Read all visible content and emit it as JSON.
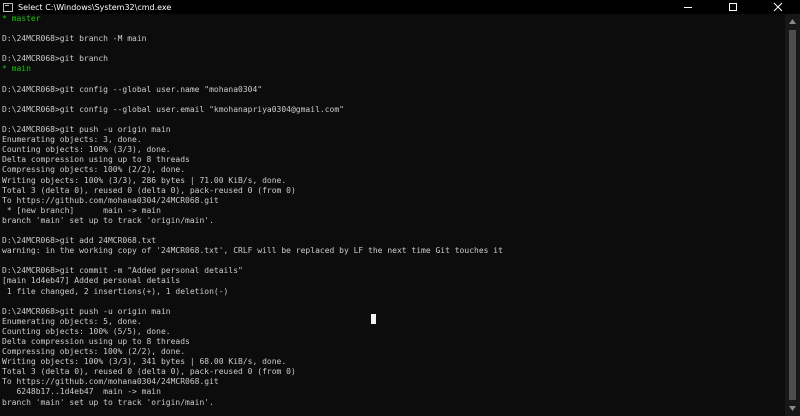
{
  "window": {
    "title": "Select C:\\Windows\\System32\\cmd.exe",
    "icon": "console-icon",
    "controls": [
      "minimize-icon",
      "maximize-icon",
      "close-icon"
    ]
  },
  "colors": {
    "background": "#0c0c0c",
    "text": "#cccccc",
    "branch_highlight": "#16c60c"
  },
  "console": {
    "lines": [
      {
        "text": "* master",
        "style": "green"
      },
      {
        "text": "",
        "style": "normal"
      },
      {
        "text": "D:\\24MCR068>git branch -M main",
        "style": "normal"
      },
      {
        "text": "",
        "style": "normal"
      },
      {
        "text": "D:\\24MCR068>git branch",
        "style": "normal"
      },
      {
        "text": "* main",
        "style": "green"
      },
      {
        "text": "",
        "style": "normal"
      },
      {
        "text": "D:\\24MCR068>git config --global user.name \"mohana0304\"",
        "style": "normal"
      },
      {
        "text": "",
        "style": "normal"
      },
      {
        "text": "D:\\24MCR068>git config --global user.email \"kmohanapriya0304@gmail.com\"",
        "style": "normal"
      },
      {
        "text": "",
        "style": "normal"
      },
      {
        "text": "D:\\24MCR068>git push -u origin main",
        "style": "normal"
      },
      {
        "text": "Enumerating objects: 3, done.",
        "style": "normal"
      },
      {
        "text": "Counting objects: 100% (3/3), done.",
        "style": "normal"
      },
      {
        "text": "Delta compression using up to 8 threads",
        "style": "normal"
      },
      {
        "text": "Compressing objects: 100% (2/2), done.",
        "style": "normal"
      },
      {
        "text": "Writing objects: 100% (3/3), 286 bytes | 71.00 KiB/s, done.",
        "style": "normal"
      },
      {
        "text": "Total 3 (delta 0), reused 0 (delta 0), pack-reused 0 (from 0)",
        "style": "normal"
      },
      {
        "text": "To https://github.com/mohana0304/24MCR068.git",
        "style": "normal"
      },
      {
        "text": " * [new branch]      main -> main",
        "style": "normal"
      },
      {
        "text": "branch 'main' set up to track 'origin/main'.",
        "style": "normal"
      },
      {
        "text": "",
        "style": "normal"
      },
      {
        "text": "D:\\24MCR068>git add 24MCR068.txt",
        "style": "normal"
      },
      {
        "text": "warning: in the working copy of '24MCR068.txt', CRLF will be replaced by LF the next time Git touches it",
        "style": "normal"
      },
      {
        "text": "",
        "style": "normal"
      },
      {
        "text": "D:\\24MCR068>git commit -m \"Added personal details\"",
        "style": "normal"
      },
      {
        "text": "[main 1d4eb47] Added personal details",
        "style": "normal"
      },
      {
        "text": " 1 file changed, 2 insertions(+), 1 deletion(-)",
        "style": "normal"
      },
      {
        "text": "",
        "style": "normal"
      },
      {
        "text": "D:\\24MCR068>git push -u origin main",
        "style": "normal"
      },
      {
        "text": "Enumerating objects: 5, done.",
        "style": "normal"
      },
      {
        "text": "Counting objects: 100% (5/5), done.",
        "style": "normal"
      },
      {
        "text": "Delta compression using up to 8 threads",
        "style": "normal"
      },
      {
        "text": "Compressing objects: 100% (2/2), done.",
        "style": "normal"
      },
      {
        "text": "Writing objects: 100% (3/3), 341 bytes | 68.00 KiB/s, done.",
        "style": "normal"
      },
      {
        "text": "Total 3 (delta 0), reused 0 (delta 0), pack-reused 0 (from 0)",
        "style": "normal"
      },
      {
        "text": "To https://github.com/mohana0304/24MCR068.git",
        "style": "normal"
      },
      {
        "text": "   6248b17..1d4eb47  main -> main",
        "style": "normal"
      },
      {
        "text": "branch 'main' set up to track 'origin/main'.",
        "style": "normal"
      }
    ]
  }
}
